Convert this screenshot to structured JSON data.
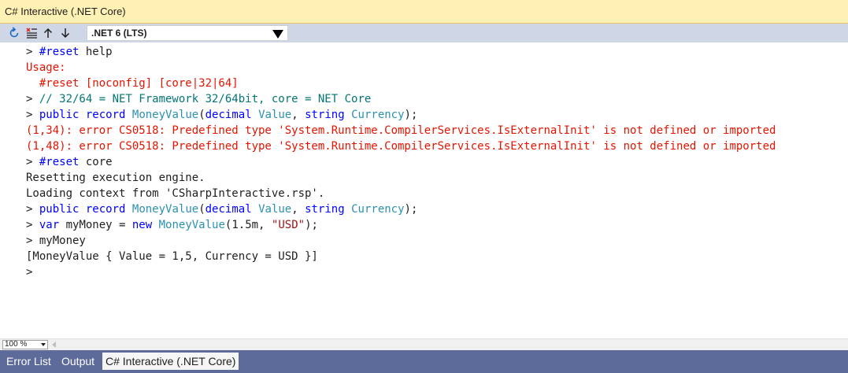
{
  "window": {
    "title": "C# Interactive (.NET Core)"
  },
  "toolbar": {
    "icons": [
      "reset-icon",
      "clear-icon",
      "history-up-icon",
      "history-down-icon"
    ],
    "runtime_select": {
      "value": ".NET 6 (LTS)"
    }
  },
  "console": {
    "lines": [
      [
        {
          "t": "> ",
          "c": ""
        },
        {
          "t": "#reset",
          "c": "kw"
        },
        {
          "t": " help",
          "c": ""
        }
      ],
      [
        {
          "t": "Usage:",
          "c": "err"
        }
      ],
      [
        {
          "t": "  #reset [noconfig] [core|32|64]",
          "c": "err"
        }
      ],
      [
        {
          "t": "> ",
          "c": ""
        },
        {
          "t": "// 32/64 = NET Framework 32/64bit, core = NET Core",
          "c": "cmt"
        }
      ],
      [
        {
          "t": "> ",
          "c": ""
        },
        {
          "t": "public",
          "c": "kw"
        },
        {
          "t": " ",
          "c": ""
        },
        {
          "t": "record",
          "c": "kw"
        },
        {
          "t": " ",
          "c": ""
        },
        {
          "t": "MoneyValue",
          "c": "ty"
        },
        {
          "t": "(",
          "c": ""
        },
        {
          "t": "decimal",
          "c": "kw"
        },
        {
          "t": " ",
          "c": ""
        },
        {
          "t": "Value",
          "c": "ty"
        },
        {
          "t": ", ",
          "c": ""
        },
        {
          "t": "string",
          "c": "kw"
        },
        {
          "t": " ",
          "c": ""
        },
        {
          "t": "Currency",
          "c": "ty"
        },
        {
          "t": ");",
          "c": ""
        }
      ],
      [
        {
          "t": "(1,34): error CS0518: Predefined type 'System.Runtime.CompilerServices.IsExternalInit' is not defined or imported",
          "c": "err"
        }
      ],
      [
        {
          "t": "(1,48): error CS0518: Predefined type 'System.Runtime.CompilerServices.IsExternalInit' is not defined or imported",
          "c": "err"
        }
      ],
      [
        {
          "t": "> ",
          "c": ""
        },
        {
          "t": "#reset",
          "c": "kw"
        },
        {
          "t": " core",
          "c": ""
        }
      ],
      [
        {
          "t": "Resetting execution engine.",
          "c": ""
        }
      ],
      [
        {
          "t": "Loading context from 'CSharpInteractive.rsp'.",
          "c": ""
        }
      ],
      [
        {
          "t": "> ",
          "c": ""
        },
        {
          "t": "public",
          "c": "kw"
        },
        {
          "t": " ",
          "c": ""
        },
        {
          "t": "record",
          "c": "kw"
        },
        {
          "t": " ",
          "c": ""
        },
        {
          "t": "MoneyValue",
          "c": "ty"
        },
        {
          "t": "(",
          "c": ""
        },
        {
          "t": "decimal",
          "c": "kw"
        },
        {
          "t": " ",
          "c": ""
        },
        {
          "t": "Value",
          "c": "ty"
        },
        {
          "t": ", ",
          "c": ""
        },
        {
          "t": "string",
          "c": "kw"
        },
        {
          "t": " ",
          "c": ""
        },
        {
          "t": "Currency",
          "c": "ty"
        },
        {
          "t": ");",
          "c": ""
        }
      ],
      [
        {
          "t": "> ",
          "c": ""
        },
        {
          "t": "var",
          "c": "kw"
        },
        {
          "t": " myMoney = ",
          "c": ""
        },
        {
          "t": "new",
          "c": "kw"
        },
        {
          "t": " ",
          "c": ""
        },
        {
          "t": "MoneyValue",
          "c": "ty"
        },
        {
          "t": "(1.5m, ",
          "c": ""
        },
        {
          "t": "\"USD\"",
          "c": "str"
        },
        {
          "t": ");",
          "c": ""
        }
      ],
      [
        {
          "t": "> myMoney",
          "c": ""
        }
      ],
      [
        {
          "t": "[MoneyValue { Value = 1,5, Currency = USD }]",
          "c": ""
        }
      ],
      [
        {
          "t": ">",
          "c": ""
        }
      ]
    ]
  },
  "status": {
    "zoom": "100 %"
  },
  "tabs": [
    {
      "label": "Error List",
      "active": false
    },
    {
      "label": "Output",
      "active": false
    },
    {
      "label": "C# Interactive (.NET Core)",
      "active": true
    }
  ],
  "colors": {
    "keyword": "#0000ff",
    "type": "#2b91af",
    "string": "#a31515",
    "error": "#e51400",
    "comment": "#057575",
    "title_bg": "#fff0b3",
    "toolbar_bg": "#cfd6e5",
    "tabs_bg": "#5c6b99"
  }
}
